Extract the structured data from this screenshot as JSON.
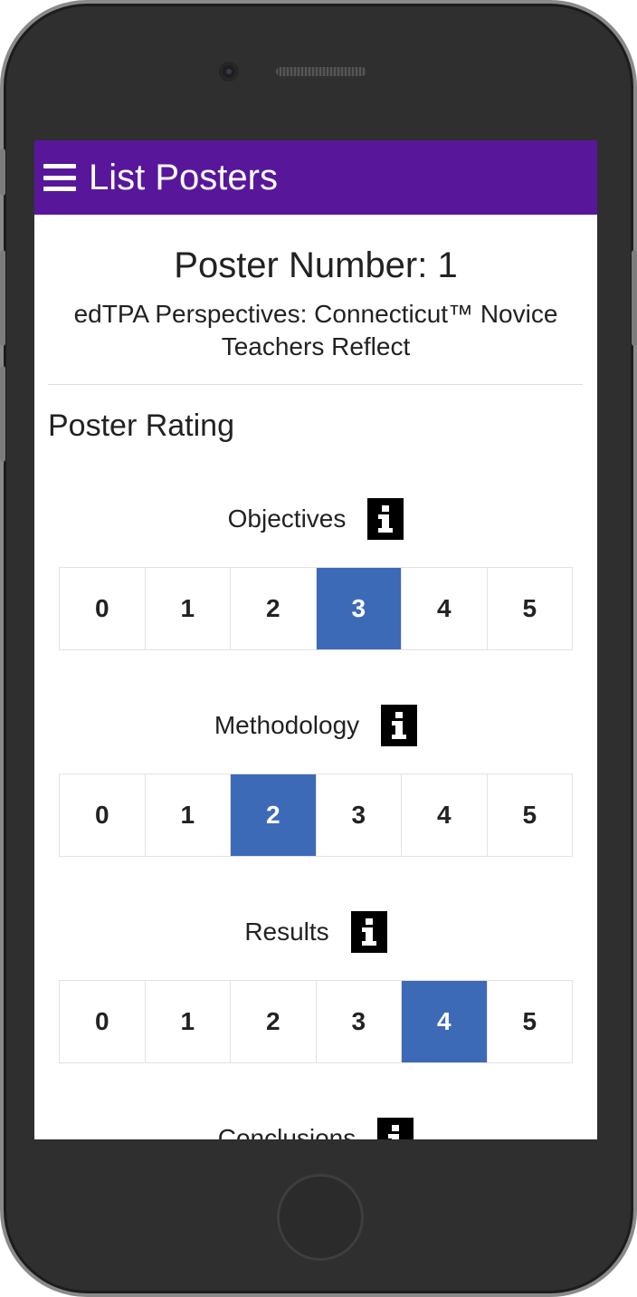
{
  "app_bar": {
    "title": "List Posters",
    "menu_icon": "hamburger-menu-icon",
    "background_color": "#58179a"
  },
  "poster": {
    "number_label": "Poster Number: 1",
    "title": "edTPA Perspectives: Connecticut™ Novice Teachers Reflect"
  },
  "rating_section": {
    "heading": "Poster Rating",
    "selected_color": "#3d6ab7",
    "info_icon": "info-icon",
    "criteria": [
      {
        "label": "Objectives",
        "info_glyph": "i",
        "options": [
          "0",
          "1",
          "2",
          "3",
          "4",
          "5"
        ],
        "selected": "3"
      },
      {
        "label": "Methodology",
        "info_glyph": "i",
        "options": [
          "0",
          "1",
          "2",
          "3",
          "4",
          "5"
        ],
        "selected": "2"
      },
      {
        "label": "Results",
        "info_glyph": "i",
        "options": [
          "0",
          "1",
          "2",
          "3",
          "4",
          "5"
        ],
        "selected": "4"
      },
      {
        "label": "Conclusions",
        "info_glyph": "i"
      }
    ]
  }
}
